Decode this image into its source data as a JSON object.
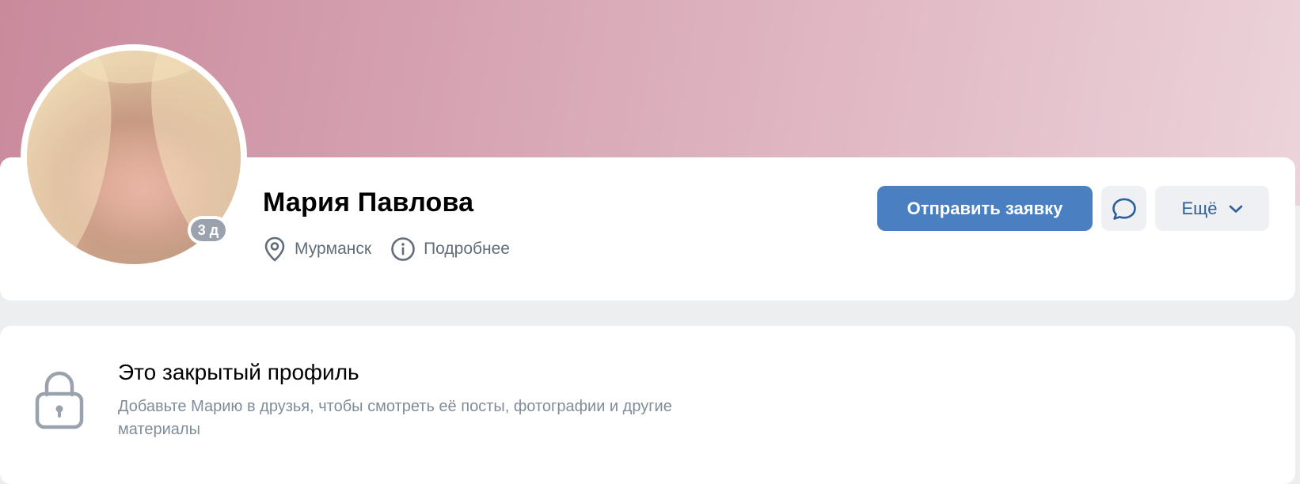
{
  "profile": {
    "name": "Мария Павлова",
    "online_badge": "3 д",
    "city": "Мурманск",
    "details_link": "Подробнее"
  },
  "actions": {
    "send_request": "Отправить заявку",
    "more": "Ещё"
  },
  "closed_profile": {
    "title": "Это закрытый профиль",
    "description": "Добавьте Марию в друзья, чтобы смотреть её посты, фотографии и другие материалы"
  },
  "colors": {
    "accent": "#4a7fc1",
    "link": "#2d5f9e",
    "secondary_text": "#626d7a",
    "muted_text": "#818c99",
    "badge": "#99a2ad",
    "page_background": "#edeef0"
  },
  "icons": {
    "location": "location-pin-icon",
    "info": "info-icon",
    "message": "message-bubble-icon",
    "more": "chevron-down-icon",
    "lock": "lock-icon"
  }
}
